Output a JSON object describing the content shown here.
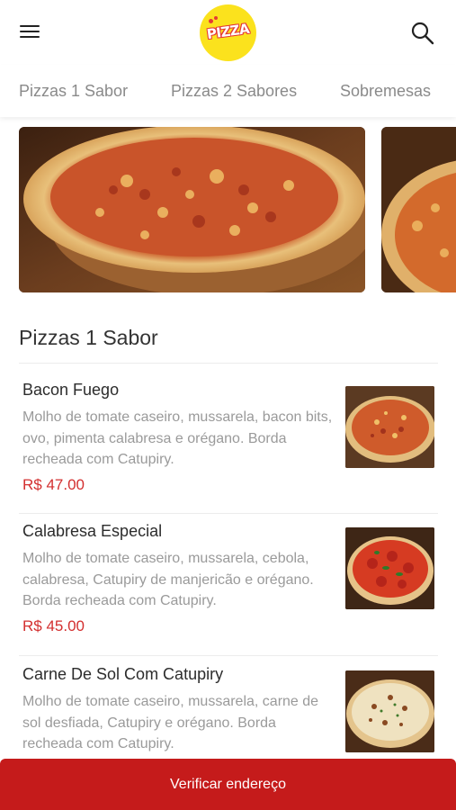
{
  "header": {
    "logo_text": "PIZZA",
    "menu_icon": "hamburger-menu-icon",
    "search_icon": "search-icon"
  },
  "tabs": [
    {
      "label": "Pizzas 1 Sabor"
    },
    {
      "label": "Pizzas 2 Sabores"
    },
    {
      "label": "Sobremesas"
    }
  ],
  "section": {
    "title": "Pizzas 1 Sabor"
  },
  "items": [
    {
      "name": "Bacon Fuego",
      "description": "Molho de tomate caseiro, mussarela, bacon bits, ovo, pimenta calabresa e orégano. Borda recheada com Catupiry.",
      "price": "R$ 47.00"
    },
    {
      "name": "Calabresa Especial",
      "description": "Molho de tomate caseiro, mussarela, cebola, calabresa, Catupiry de manjericão e orégano. Borda recheada com Catupiry.",
      "price": "R$ 45.00"
    },
    {
      "name": "Carne De Sol Com Catupiry",
      "description": "Molho de tomate caseiro, mussarela, carne de sol desfiada, Catupiry e orégano. Borda recheada com Catupiry.",
      "price": ""
    }
  ],
  "cta": {
    "label": "Verificar endereço"
  },
  "colors": {
    "accent": "#c51b1b",
    "price": "#d32f2f",
    "logo_bg": "#fbe21d"
  }
}
